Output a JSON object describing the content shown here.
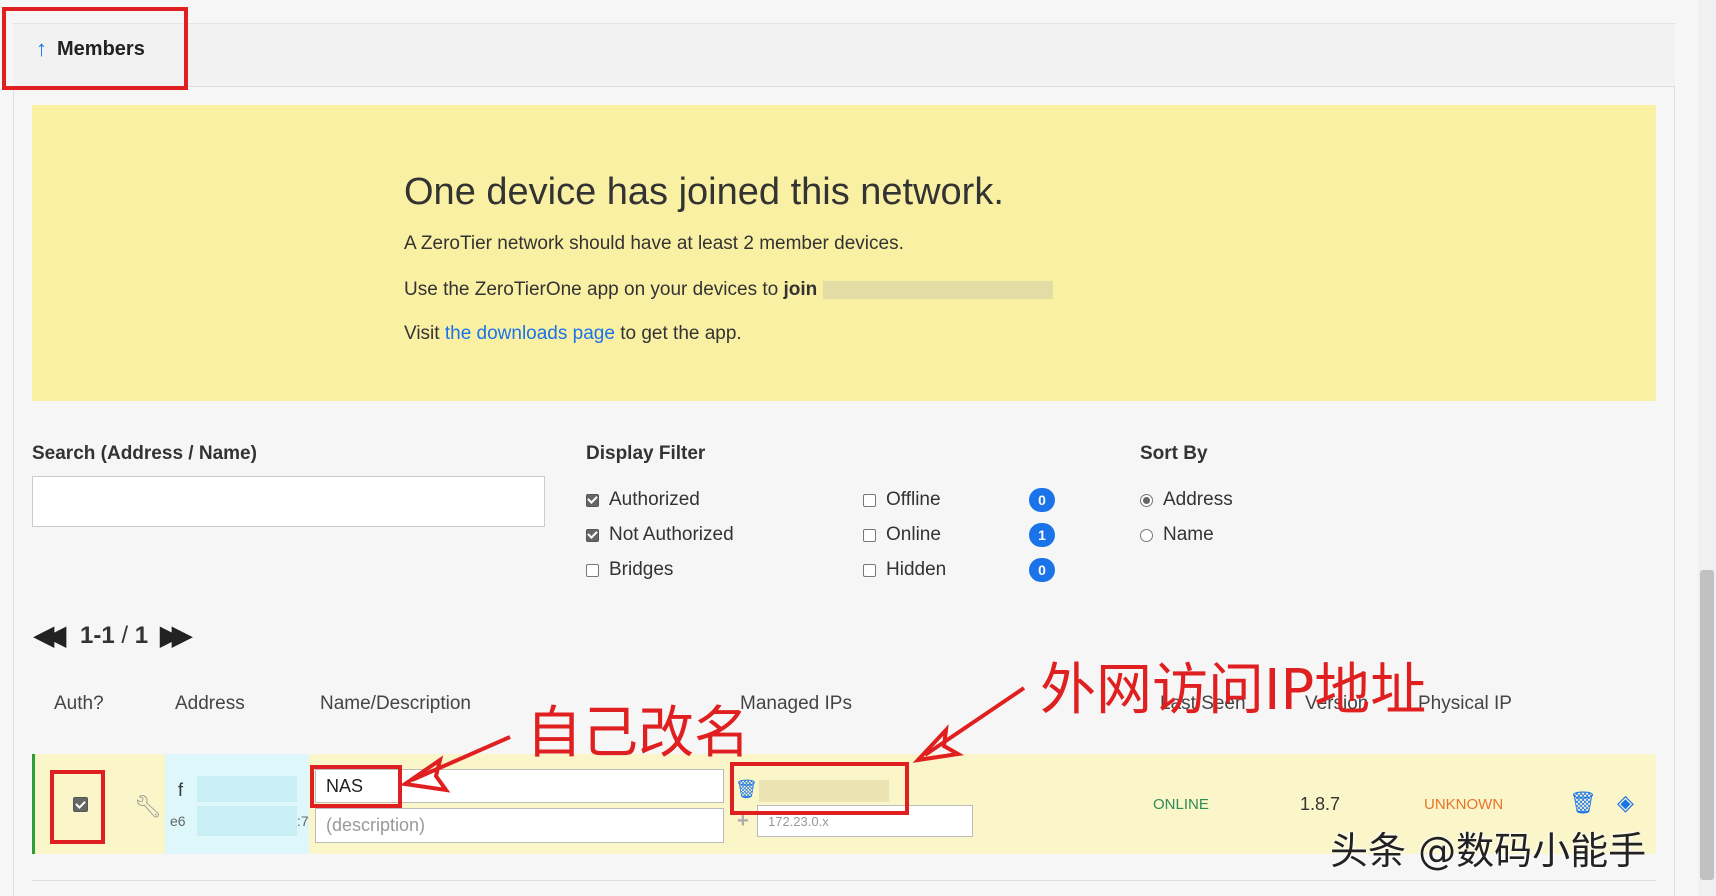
{
  "header": {
    "title": "Members"
  },
  "banner": {
    "heading": "One device has joined this network.",
    "line1": "A ZeroTier network should have at least 2 member devices.",
    "line2_prefix": "Use the ZeroTierOne app on your devices to",
    "line2_bold": "join",
    "line3_prefix": "Visit",
    "line3_link": "the downloads page",
    "line3_suffix": "to get the app."
  },
  "search": {
    "label": "Search (Address / Name)",
    "value": ""
  },
  "display_filter": {
    "label": "Display Filter",
    "options": [
      {
        "label": "Authorized",
        "checked": true
      },
      {
        "label": "Not Authorized",
        "checked": true
      },
      {
        "label": "Bridges",
        "checked": false
      },
      {
        "label": "Offline",
        "checked": false,
        "count": "0"
      },
      {
        "label": "Online",
        "checked": false,
        "count": "1"
      },
      {
        "label": "Hidden",
        "checked": false,
        "count": "0"
      }
    ]
  },
  "sort_by": {
    "label": "Sort By",
    "options": [
      {
        "label": "Address",
        "selected": true
      },
      {
        "label": "Name",
        "selected": false
      }
    ]
  },
  "pagination": {
    "range": "1-1",
    "separator": "/",
    "total": "1"
  },
  "table": {
    "headers": [
      "Auth?",
      "Address",
      "Name/Description",
      "Managed IPs",
      "Last Seen",
      "Version",
      "Physical IP"
    ]
  },
  "member": {
    "authorized": true,
    "address_line1": "f",
    "address_line2": "e6",
    "address_suffix": ":7",
    "name": "NAS",
    "description_placeholder": "(description)",
    "managed_ip_placeholder": "172.23.0.x",
    "last_seen": "ONLINE",
    "version": "1.8.7",
    "physical_ip": "UNKNOWN"
  },
  "annotations": {
    "rename": "自己改名",
    "external_ip": "外网访问IP地址"
  },
  "watermark": "头条 @数码小能手",
  "colors": {
    "banner_bg": "#faf0a4",
    "accent_blue": "#1a73e8",
    "annotation_red": "#e02020",
    "online_green": "#2e8b57",
    "unknown_orange": "#e8742a"
  }
}
